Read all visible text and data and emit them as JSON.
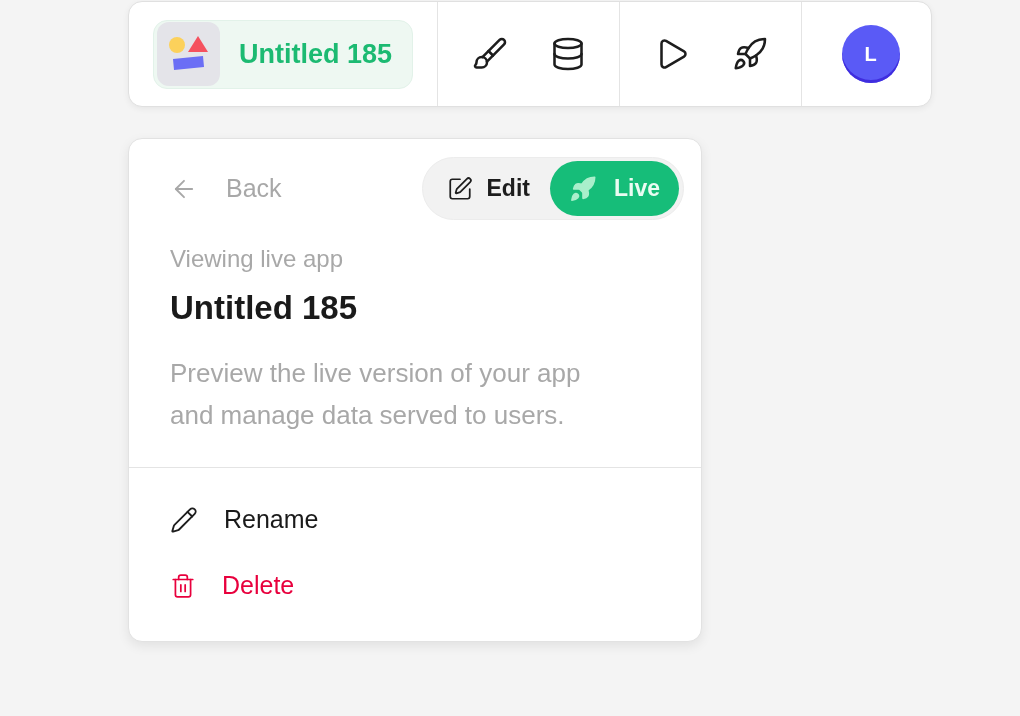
{
  "toolbar": {
    "app": {
      "name": "Untitled 185"
    },
    "avatar": {
      "initial": "L"
    }
  },
  "panel": {
    "back": "Back",
    "mode_toggle": [
      {
        "label": "Edit",
        "selected": false
      },
      {
        "label": "Live",
        "selected": true
      }
    ],
    "eyebrow": "Viewing live app",
    "title": "Untitled 185",
    "description": "Preview the live version of your app and manage data served to users.",
    "actions": [
      {
        "label": "Rename",
        "kind": "default"
      },
      {
        "label": "Delete",
        "kind": "danger"
      }
    ]
  }
}
